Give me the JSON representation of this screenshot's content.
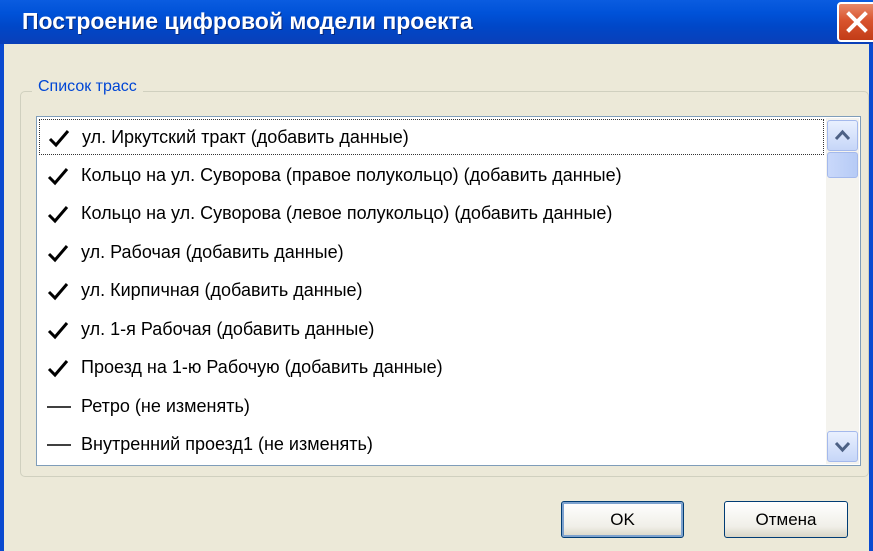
{
  "window": {
    "title": "Построение цифровой модели проекта"
  },
  "group": {
    "label": "Список трасс"
  },
  "list": {
    "items": [
      {
        "label": "ул. Иркутский тракт (добавить данные)",
        "state": "checked",
        "focused": true
      },
      {
        "label": "Кольцо на ул. Суворова (правое полукольцо) (добавить данные)",
        "state": "checked"
      },
      {
        "label": "Кольцо на ул. Суворова (левое полукольцо) (добавить данные)",
        "state": "checked"
      },
      {
        "label": "ул. Рабочая (добавить данные)",
        "state": "checked"
      },
      {
        "label": "ул. Кирпичная (добавить данные)",
        "state": "checked"
      },
      {
        "label": "ул. 1-я Рабочая  (добавить данные)",
        "state": "checked"
      },
      {
        "label": "Проезд на 1-ю Рабочую  (добавить данные)",
        "state": "checked"
      },
      {
        "label": "Ретро (не изменять)",
        "state": "unchanged"
      },
      {
        "label": "Внутренний проезд1 (не изменять)",
        "state": "unchanged"
      }
    ]
  },
  "buttons": {
    "ok": "OK",
    "cancel": "Отмена"
  },
  "icons": {
    "close": "close-icon",
    "checked": "checkmark-icon",
    "unchanged": "dash-icon",
    "scroll_up": "chevron-up-icon",
    "scroll_down": "chevron-down-icon"
  },
  "colors": {
    "titlebar": "#0052d8",
    "dialog_bg": "#ece9d8",
    "group_label": "#0046d5",
    "close_button": "#d9542e"
  }
}
